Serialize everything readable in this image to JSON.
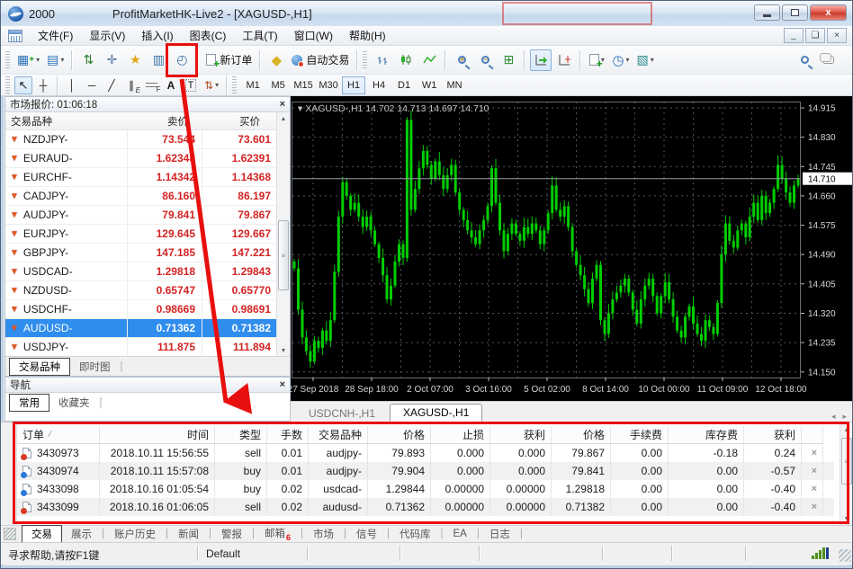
{
  "window": {
    "title_number": "2000",
    "title": "ProfitMarketHK-Live2 - [XAGUSD-,H1]"
  },
  "menu": {
    "items": [
      "文件(F)",
      "显示(V)",
      "插入(I)",
      "图表(C)",
      "工具(T)",
      "窗口(W)",
      "帮助(H)"
    ]
  },
  "icons": {
    "new_chart": "▦",
    "profiles": "▤",
    "market_watch": "⇅",
    "data_window": "✛",
    "navigator": "★",
    "terminal": "▥",
    "tester": "◴",
    "metaeditor": "◆",
    "tile": "⊞",
    "periods": "◷",
    "templates": "▧",
    "dropdown": "▾",
    "cursor": "↖",
    "crosshair": "┼",
    "vline": "│",
    "hline": "─",
    "trendline": "╱",
    "channel": "∥",
    "text": "A",
    "label": "T",
    "arrows": "⇅",
    "price_down": "▼",
    "close": "×",
    "up": "▲",
    "down": "▼",
    "left": "◂",
    "right": "▸",
    "thumb": "≡",
    "sort": "∕",
    "min": "",
    "restore": "",
    "zoom_in": "+",
    "zoom_out": "−",
    "fibo_letter": "F",
    "channel_letter": "E"
  },
  "toolbar": {
    "new_order_label": "新订单",
    "autotrade_label": "自动交易",
    "timeframes": [
      {
        "label": "M1"
      },
      {
        "label": "M5"
      },
      {
        "label": "M15"
      },
      {
        "label": "M30"
      },
      {
        "label": "H1",
        "active": true
      },
      {
        "label": "H4"
      },
      {
        "label": "D1"
      },
      {
        "label": "W1"
      },
      {
        "label": "MN"
      }
    ]
  },
  "market_watch": {
    "title": "市场报价: 01:06:18",
    "columns": [
      "交易品种",
      "卖价",
      "买价"
    ],
    "rows": [
      {
        "symbol": "NZDJPY-",
        "bid": "73.544",
        "ask": "73.601"
      },
      {
        "symbol": "EURAUD-",
        "bid": "1.62348",
        "ask": "1.62391"
      },
      {
        "symbol": "EURCHF-",
        "bid": "1.14342",
        "ask": "1.14368"
      },
      {
        "symbol": "CADJPY-",
        "bid": "86.160",
        "ask": "86.197"
      },
      {
        "symbol": "AUDJPY-",
        "bid": "79.841",
        "ask": "79.867"
      },
      {
        "symbol": "EURJPY-",
        "bid": "129.645",
        "ask": "129.667"
      },
      {
        "symbol": "GBPJPY-",
        "bid": "147.185",
        "ask": "147.221"
      },
      {
        "symbol": "USDCAD-",
        "bid": "1.29818",
        "ask": "1.29843"
      },
      {
        "symbol": "NZDUSD-",
        "bid": "0.65747",
        "ask": "0.65770"
      },
      {
        "symbol": "USDCHF-",
        "bid": "0.98669",
        "ask": "0.98691"
      },
      {
        "symbol": "AUDUSD-",
        "bid": "0.71362",
        "ask": "0.71382",
        "selected": true
      },
      {
        "symbol": "USDJPY-",
        "bid": "111.875",
        "ask": "111.894"
      }
    ],
    "tabs": [
      {
        "label": "交易品种",
        "active": true
      },
      {
        "label": "即时图"
      }
    ]
  },
  "navigator": {
    "title": "导航",
    "tabs": [
      {
        "label": "常用",
        "active": true
      },
      {
        "label": "收藏夹"
      }
    ]
  },
  "chart_tabs": [
    {
      "label": "USDCNH-,H1"
    },
    {
      "label": "XAGUSD-,H1",
      "active": true
    }
  ],
  "chart_data": {
    "type": "candlestick",
    "symbol": "XAGUSD-",
    "timeframe": "H1",
    "title": "XAGUSD-,H1",
    "ohlc": {
      "open": 14.702,
      "high": 14.713,
      "low": 14.697,
      "close": 14.71
    },
    "current_price": 14.71,
    "ylim": [
      14.13,
      14.945
    ],
    "y_ticks": [
      14.915,
      14.83,
      14.745,
      14.66,
      14.575,
      14.49,
      14.405,
      14.32,
      14.235,
      14.15
    ],
    "x_labels": [
      "27 Sep 2018",
      "28 Sep 18:00",
      "2 Oct 07:00",
      "3 Oct 16:00",
      "5 Oct 02:00",
      "8 Oct 14:00",
      "10 Oct 00:00",
      "11 Oct 09:00",
      "12 Oct 18:00"
    ],
    "grid": true,
    "bg": "#000000",
    "candle_color": "#00CE00",
    "grid_color": "#54545e",
    "closes": [
      14.45,
      14.33,
      14.25,
      14.21,
      14.18,
      14.24,
      14.22,
      14.27,
      14.24,
      14.3,
      14.44,
      14.6,
      14.7,
      14.66,
      14.62,
      14.64,
      14.6,
      14.57,
      14.6,
      14.56,
      14.52,
      14.48,
      14.43,
      14.36,
      14.4,
      14.47,
      14.52,
      14.48,
      14.88,
      14.62,
      14.68,
      14.74,
      14.79,
      14.75,
      14.71,
      14.76,
      14.72,
      14.68,
      14.72,
      14.75,
      14.67,
      14.62,
      14.59,
      14.56,
      14.54,
      14.52,
      14.56,
      14.59,
      14.63,
      14.74,
      14.64,
      14.56,
      14.5,
      14.55,
      14.58,
      14.55,
      14.53,
      14.57,
      14.55,
      14.58,
      14.56,
      14.52,
      14.56,
      14.61,
      14.69,
      14.62,
      14.6,
      14.63,
      14.57,
      14.5,
      14.46,
      14.43,
      14.39,
      14.35,
      14.42,
      14.46,
      14.3,
      14.26,
      14.32,
      14.36,
      14.38,
      14.4,
      14.42,
      14.38,
      14.33,
      14.29,
      14.36,
      14.4,
      14.42,
      14.37,
      14.32,
      14.37,
      14.41,
      14.36,
      14.31,
      14.27,
      14.25,
      14.31,
      14.34,
      14.29,
      14.26,
      14.24,
      14.3,
      14.28,
      14.26,
      14.35,
      14.49,
      14.58,
      14.53,
      14.51,
      14.56,
      14.58,
      14.54,
      14.6,
      14.64,
      14.59,
      14.66,
      14.61,
      14.64,
      14.68,
      14.75,
      14.71,
      14.67,
      14.64,
      14.69,
      14.71
    ]
  },
  "terminal": {
    "columns": [
      "订单",
      "时间",
      "类型",
      "手数",
      "交易品种",
      "价格",
      "止损",
      "获利",
      "价格",
      "手续费",
      "库存费",
      "获利"
    ],
    "orders": [
      {
        "id": "3430973",
        "time": "2018.10.11 15:56:55",
        "type": "sell",
        "lots": "0.01",
        "symbol": "audjpy-",
        "price": "79.893",
        "sl": "0.000",
        "tp": "0.000",
        "price2": "79.867",
        "commission": "0.00",
        "swap": "-0.18",
        "profit": "0.24",
        "dot": "red"
      },
      {
        "id": "3430974",
        "time": "2018.10.11 15:57:08",
        "type": "buy",
        "lots": "0.01",
        "symbol": "audjpy-",
        "price": "79.904",
        "sl": "0.000",
        "tp": "0.000",
        "price2": "79.841",
        "commission": "0.00",
        "swap": "0.00",
        "profit": "-0.57",
        "dot": "blue"
      },
      {
        "id": "3433098",
        "time": "2018.10.16 01:05:54",
        "type": "buy",
        "lots": "0.02",
        "symbol": "usdcad-",
        "price": "1.29844",
        "sl": "0.00000",
        "tp": "0.00000",
        "price2": "1.29818",
        "commission": "0.00",
        "swap": "0.00",
        "profit": "-0.40",
        "dot": "blue"
      },
      {
        "id": "3433099",
        "time": "2018.10.16 01:06:05",
        "type": "sell",
        "lots": "0.02",
        "symbol": "audusd-",
        "price": "0.71362",
        "sl": "0.00000",
        "tp": "0.00000",
        "price2": "0.71382",
        "commission": "0.00",
        "swap": "0.00",
        "profit": "-0.40",
        "dot": "red"
      }
    ]
  },
  "bottom_tabs": [
    {
      "label": "交易",
      "active": true
    },
    {
      "label": "展示"
    },
    {
      "label": "账户历史"
    },
    {
      "label": "新闻"
    },
    {
      "label": "警报"
    },
    {
      "label": "邮箱",
      "badge": "6"
    },
    {
      "label": "市场"
    },
    {
      "label": "信号"
    },
    {
      "label": "代码库"
    },
    {
      "label": "EA"
    },
    {
      "label": "日志"
    }
  ],
  "status": {
    "help": "寻求帮助,请按F1键",
    "profile": "Default"
  }
}
